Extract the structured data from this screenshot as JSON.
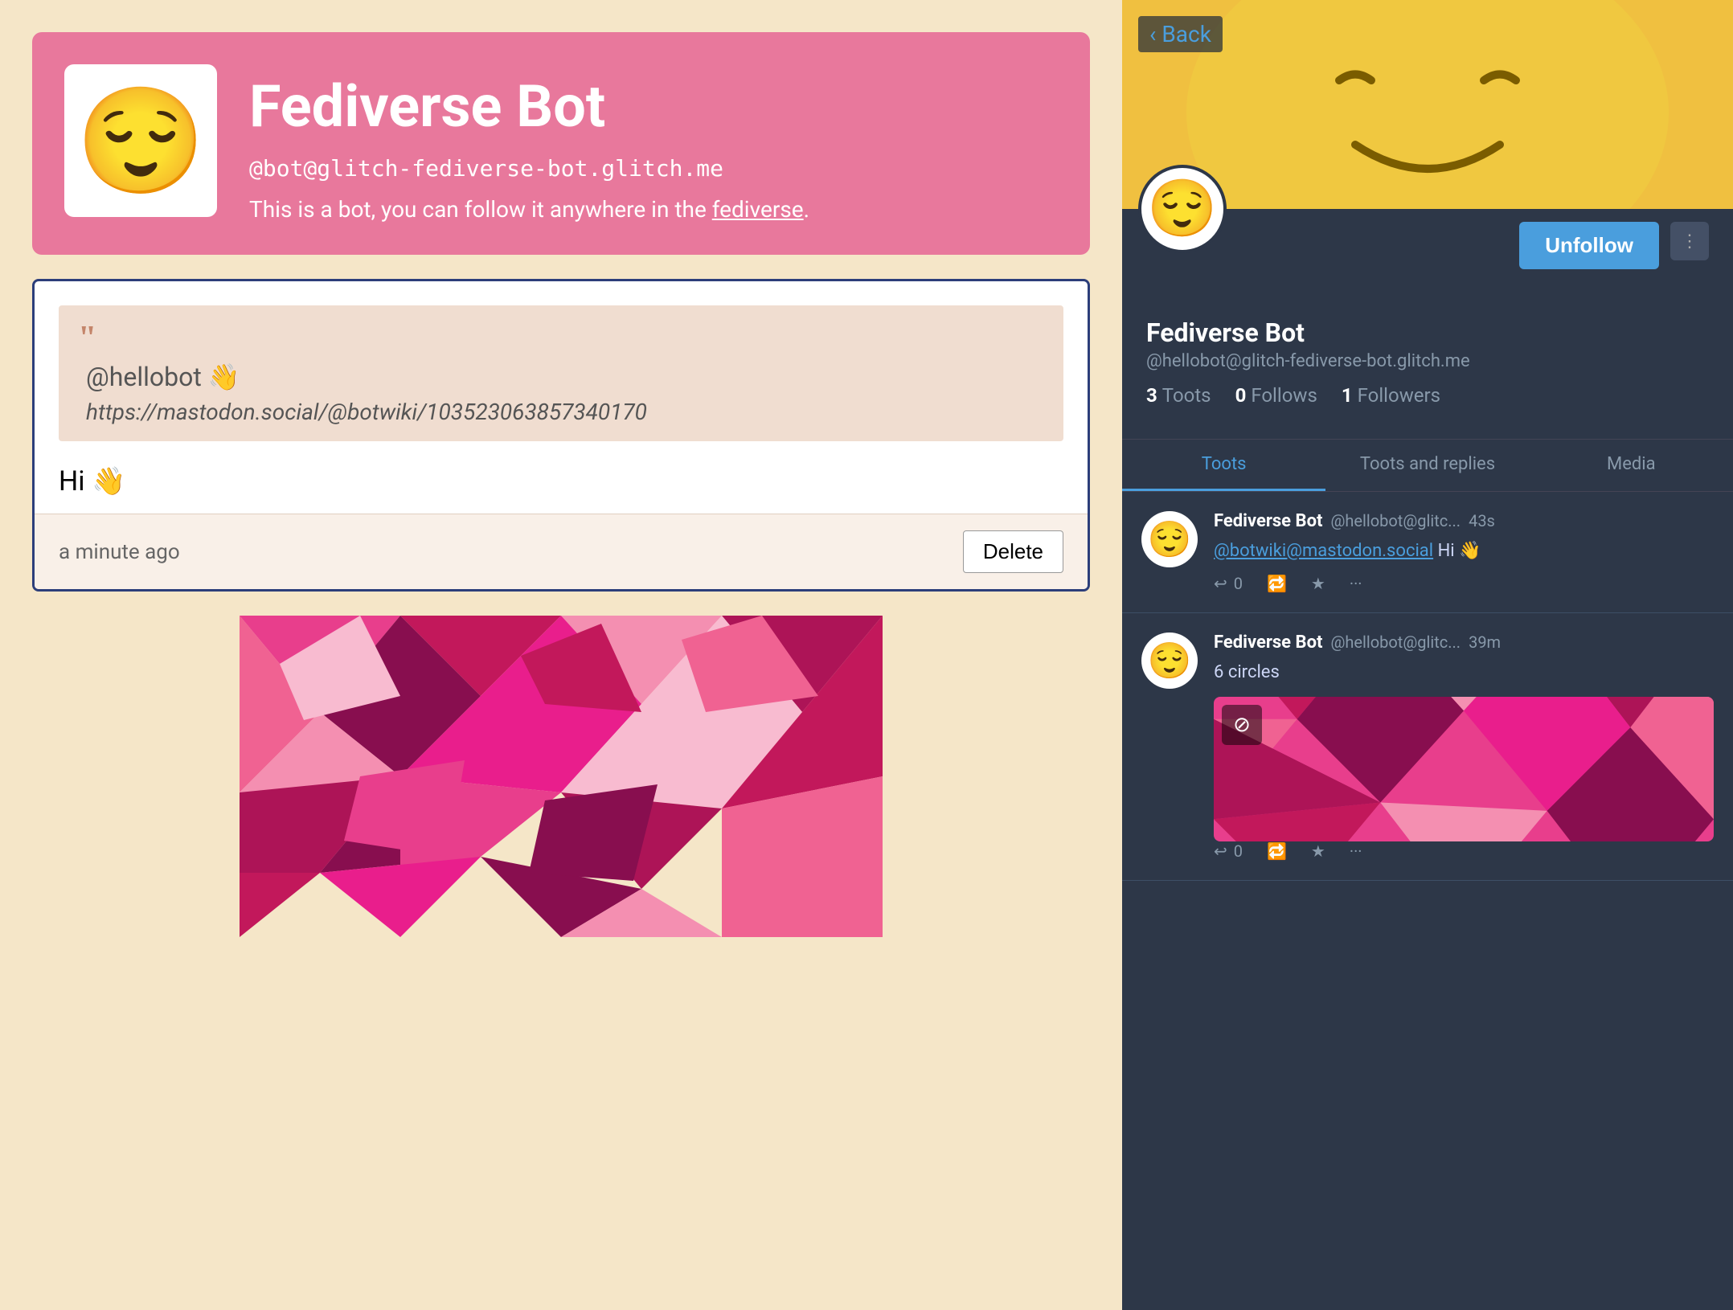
{
  "left": {
    "profile": {
      "name": "Fediverse Bot",
      "handle": "@bot@glitch-fediverse-bot.glitch.me",
      "bio_prefix": "This is a bot, you can follow it anywhere in the ",
      "bio_link": "fediverse",
      "bio_suffix": ".",
      "emoji": "😌"
    },
    "post": {
      "quote_mention": "@hellobot 👋",
      "quote_link": "https://mastodon.social/@botwiki/103523063857340170",
      "content": "Hi 👋",
      "time": "a minute ago",
      "delete_label": "Delete"
    }
  },
  "right": {
    "back_label": "Back",
    "name": "Fediverse Bot",
    "handle": "@hellobot@glitch-fediverse-bot.glitch.me",
    "emoji": "😌",
    "stats": {
      "toots": {
        "num": "3",
        "label": "Toots"
      },
      "follows": {
        "num": "0",
        "label": "Follows"
      },
      "followers": {
        "num": "1",
        "label": "Followers"
      }
    },
    "unfollow_label": "Unfollow",
    "more_label": "⋮",
    "tabs": [
      {
        "label": "Toots",
        "active": true
      },
      {
        "label": "Toots and replies",
        "active": false
      },
      {
        "label": "Media",
        "active": false
      }
    ],
    "toots": [
      {
        "name": "Fediverse Bot",
        "handle": "@hellobot@glitc...",
        "time": "43s",
        "text_prefix": "",
        "mention": "@botwiki@mastodon.social",
        "text_suffix": " Hi 👋",
        "reply_count": "0",
        "retweet_count": "",
        "fav_count": "",
        "emoji": "😌"
      },
      {
        "name": "Fediverse Bot",
        "handle": "@hellobot@glitc...",
        "time": "39m",
        "text_prefix": "6 circles",
        "mention": "",
        "text_suffix": "",
        "reply_count": "0",
        "retweet_count": "",
        "fav_count": "",
        "emoji": "😌",
        "has_media": true
      }
    ]
  }
}
